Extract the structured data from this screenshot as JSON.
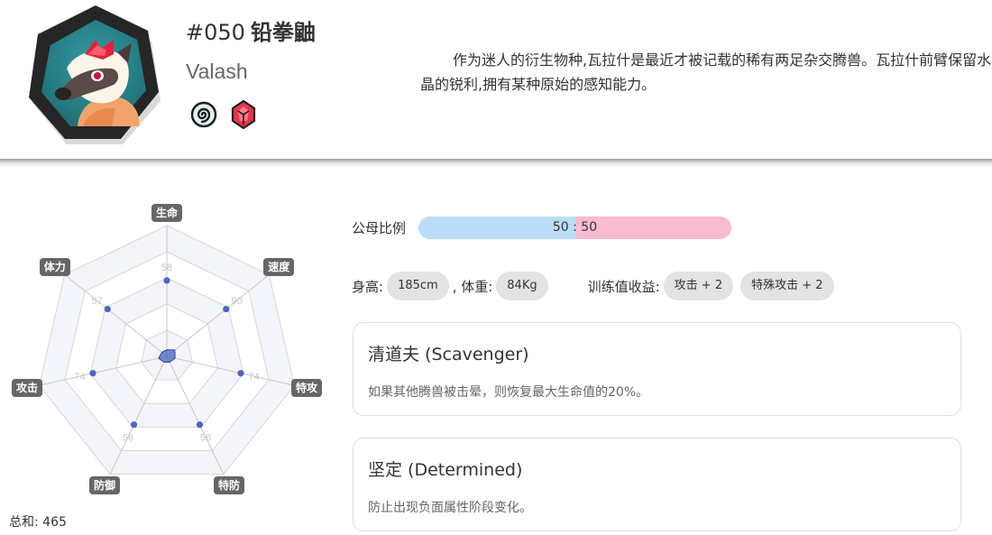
{
  "header": {
    "number": "#050",
    "name_cn": "铅拳鼬",
    "name_en": "Valash",
    "description": "作为迷人的衍生物种,瓦拉什是最近才被记载的稀有两足杂交腾兽。瓦拉什前臂保留水晶的锐利,拥有某种原始的感知能力。",
    "type_icons": [
      "wind-spiral-icon",
      "crystal-icon"
    ]
  },
  "stats": {
    "labels": [
      "生命",
      "速度",
      "特攻",
      "特防",
      "防御",
      "攻击",
      "体力"
    ],
    "values": [
      58,
      90,
      74,
      56,
      56,
      74,
      57
    ],
    "total_label": "总和: 465",
    "max": 150
  },
  "gender": {
    "label": "公母比例",
    "ratio_text": "50 : 50",
    "male": 50,
    "female": 50,
    "male_color": "#bbdef8",
    "female_color": "#f8bbd0"
  },
  "body": {
    "height_label": "身高:",
    "height_value": "185cm",
    "weight_label": ", 体重:",
    "weight_value": "84Kg",
    "ev_label": "训练值收益:",
    "ev_chips": [
      "攻击 + 2",
      "特殊攻击 + 2"
    ]
  },
  "abilities": [
    {
      "title": "清道夫 (Scavenger)",
      "desc": "如果其他腾兽被击晕，则恢复最大生命值的20%。"
    },
    {
      "title": "坚定 (Determined)",
      "desc": "防止出现负面属性阶段变化。"
    }
  ]
}
